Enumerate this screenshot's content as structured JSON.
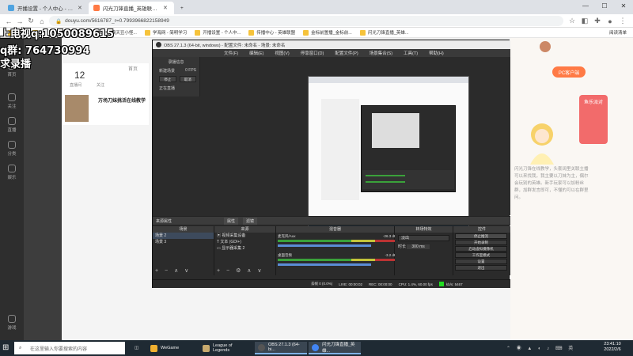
{
  "browser": {
    "tabs": [
      {
        "label": "开播设置 - 个人中心 - bilibili",
        "icon_color": "#4fa3e0",
        "active": false
      },
      {
        "label": "闪光刀锋直播_英雄联盟直播_斗鱼直播",
        "icon_color": "#ff7a45",
        "active": true
      },
      {
        "label": "+",
        "icon_color": "",
        "active": false
      }
    ],
    "address": "douyu.com/5616787_r=0.7993966822158949",
    "bookmarks": [
      "应用",
      "LoL Stats, Record...",
      "LOL中的霸天豆小怪...",
      "学海网 - 简明学习",
      "开播设置 - 个人中...",
      "传播中心 - 英雄联盟",
      "金标前置播_金标前...",
      "闪光刀锋直播_英雄..."
    ],
    "extra_bookmark": "阅读清单"
  },
  "overlay": {
    "line1": "上电视q:1050089615",
    "line2": "q群: 764730994",
    "line3": "求录播"
  },
  "page": {
    "leftnav": [
      "首页",
      "关注",
      "直播",
      "分类",
      "娱乐",
      "游戏"
    ],
    "stats": {
      "value": "12",
      "label1": "直播间",
      "label2": "关注"
    },
    "home_label": "首页",
    "title_snippet": "万场刀妹挑活在线教学",
    "pc_button": "PC客户端",
    "promo": "鱼乐派对",
    "right_text": "闪光刀锋在线教学，头套阔里关联主播可以来找我，我主要以刀妹为主，偶尔会玩别的英雄。新手玩家可以加粉丝群，加群发言即可，不懂的可以在群里问。"
  },
  "obs": {
    "title": "OBS 27.1.3 (64-bit, windows) - 配置文件: 未命名 - 场景: 未命名",
    "menu": [
      "文件(F)",
      "编辑(E)",
      "视图(V)",
      "停靠窗口(D)",
      "配置文件(P)",
      "场景集合(S)",
      "工具(T)",
      "帮助(H)"
    ],
    "left_dock": {
      "title": "录播信息",
      "line1": "新建场景",
      "value": "0 FPS",
      "btn1": "停止",
      "btn2": "取消",
      "status": "正在直播"
    },
    "dockbar_title": "来源属性",
    "dockbar_buttons": [
      "属性",
      "滤镜"
    ],
    "scenes": {
      "header": "场景",
      "items": [
        "场景 2",
        "场景 3"
      ]
    },
    "sources": {
      "header": "来源",
      "items": [
        "视频采集设备",
        "文本 (GDI+)",
        "显示器采集 2"
      ]
    },
    "mixer": {
      "header": "混音器",
      "channels": [
        {
          "name": "麦克风/Aux",
          "db": "-26.3 dB"
        },
        {
          "name": "桌面音频",
          "db": "-3.2 dB"
        }
      ]
    },
    "transitions": {
      "header": "转场特效",
      "type": "淡出",
      "duration_label": "时长",
      "duration": "300 ms"
    },
    "controls": {
      "header": "控件",
      "buttons": [
        "停止推流",
        "开始录制",
        "启动虚拟摄像机",
        "工作室模式",
        "设置",
        "退出"
      ]
    },
    "status": {
      "dropped": "丢帧 0 (0.0%)",
      "live": "LIVE: 00:00:02",
      "rec": "REC: 00:00:00",
      "cpu": "CPU: 1.4%, 60.00 fps",
      "bitrate": "kb/s: 5467"
    }
  },
  "taskbar": {
    "search_placeholder": "在这里输入你要搜索的内容",
    "apps": [
      {
        "label": "WeGame",
        "color": "#f0b030"
      },
      {
        "label": "League of Legends",
        "color": "#c8aa6e"
      },
      {
        "label": "OBS 27.1.3 (64-bi...",
        "color": "#555555"
      },
      {
        "label": "闪光刀锋直播_英雄...",
        "color": "#4285f4"
      }
    ],
    "time": "23:41:10",
    "date": "2022/2/6"
  }
}
